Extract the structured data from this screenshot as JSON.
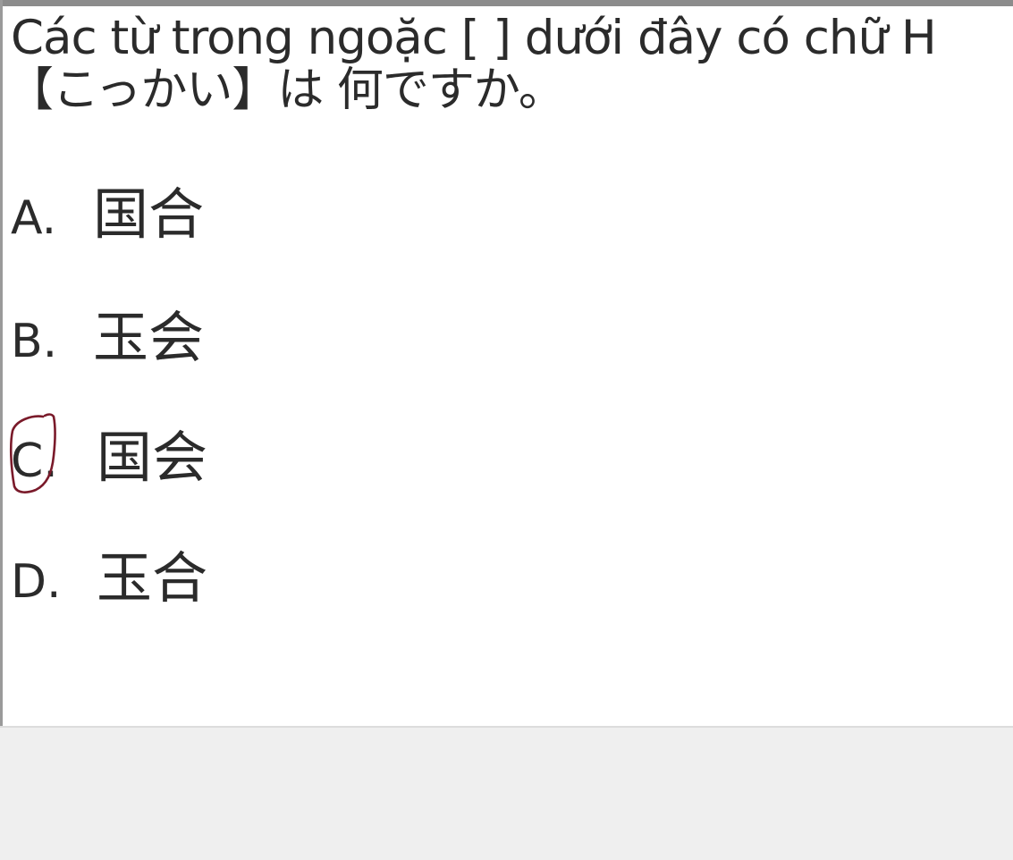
{
  "question": {
    "line1": "Các từ trong ngoặc [    ]  dưới đây có chữ H",
    "line2": "【こっかい】は  何ですか。"
  },
  "options": [
    {
      "letter": "A.",
      "text": "国合"
    },
    {
      "letter": "B.",
      "text": "玉会"
    },
    {
      "letter": "C.",
      "text": "国会"
    },
    {
      "letter": "D.",
      "text": "玉合"
    }
  ],
  "annotation": {
    "circled_option": "C",
    "mark_color": "#7a1a2a"
  },
  "colors": {
    "text": "#2b2b2b",
    "background": "#ffffff",
    "footer": "#efefef"
  }
}
